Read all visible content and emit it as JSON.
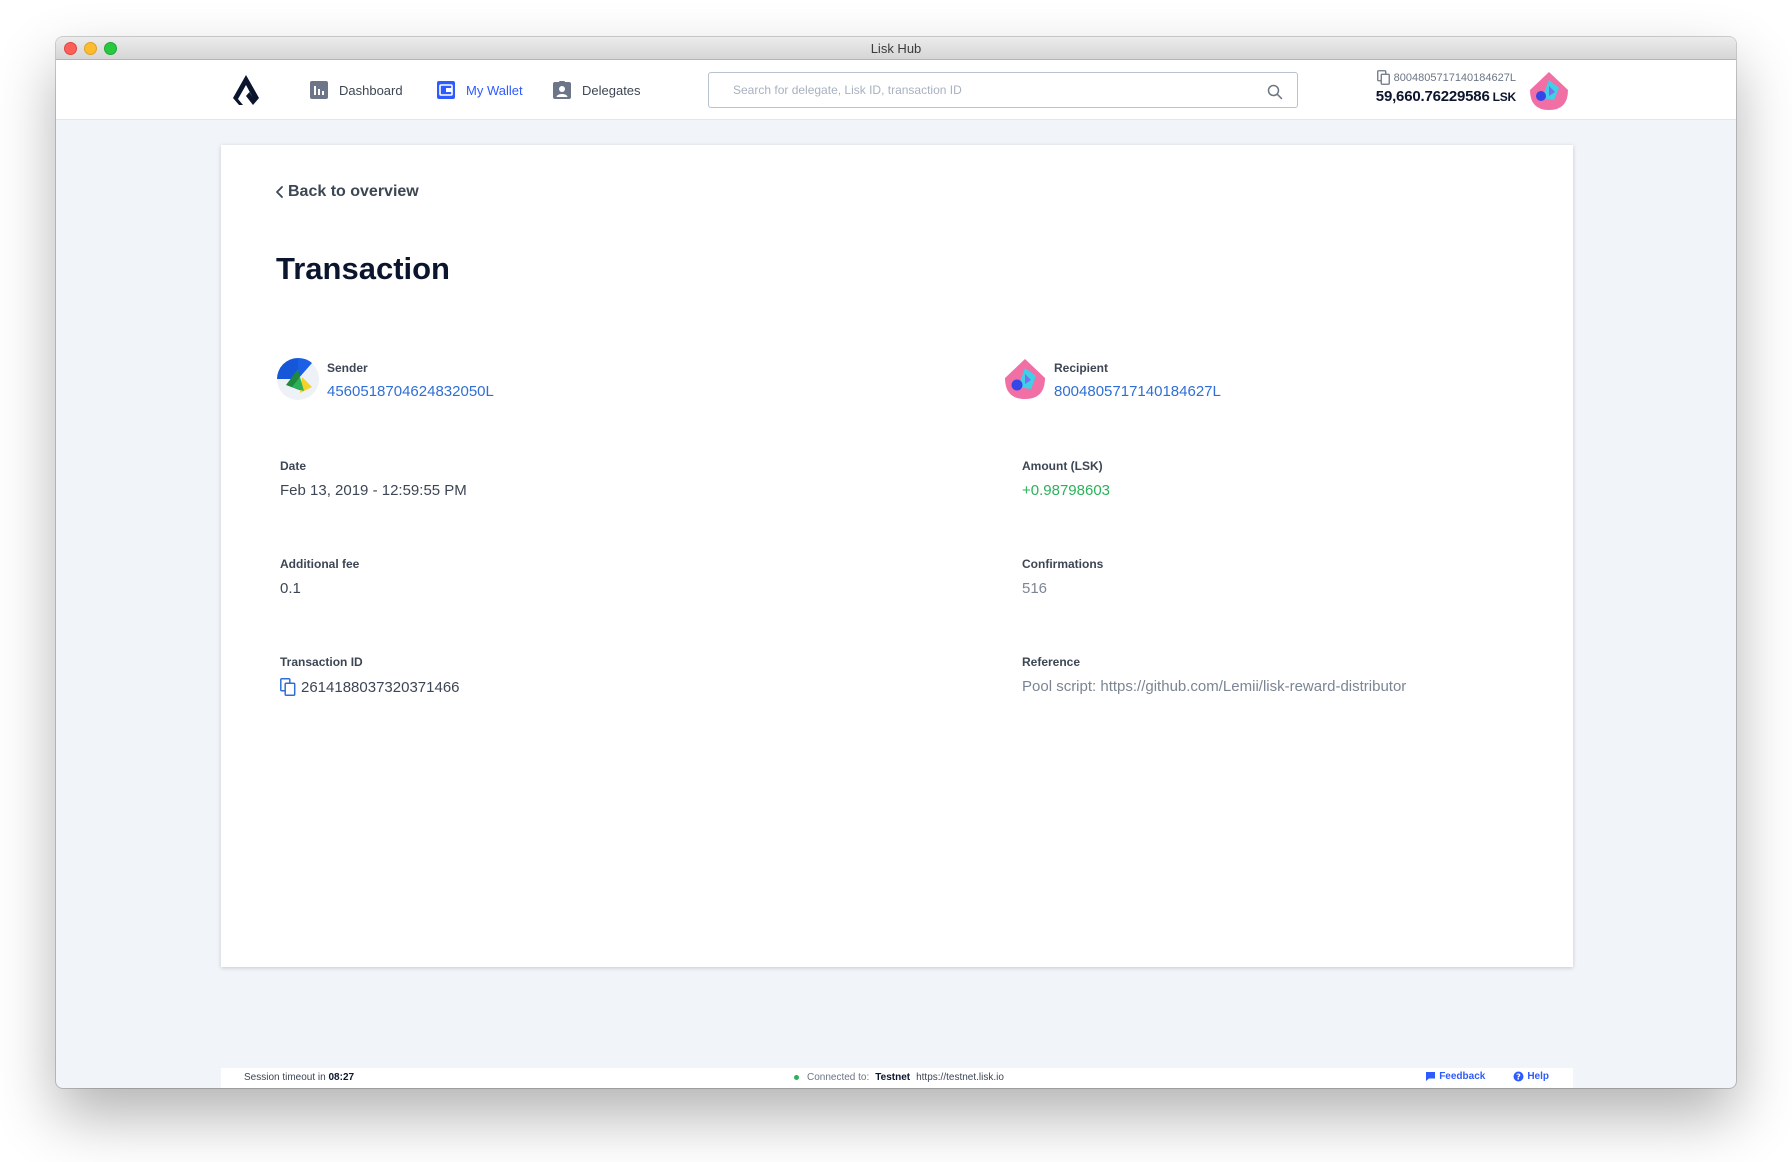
{
  "window": {
    "title": "Lisk Hub"
  },
  "nav": {
    "dashboard": "Dashboard",
    "wallet": "My Wallet",
    "delegates": "Delegates"
  },
  "search": {
    "placeholder": "Search for delegate, Lisk ID, transaction ID"
  },
  "account": {
    "address": "8004805717140184627L",
    "balance": "59,660.76229586",
    "unit": "LSK"
  },
  "page": {
    "back": "Back to overview",
    "title": "Transaction"
  },
  "transaction": {
    "sender_label": "Sender",
    "sender": "4560518704624832050L",
    "recipient_label": "Recipient",
    "recipient": "8004805717140184627L",
    "date_label": "Date",
    "date": "Feb 13, 2019 - 12:59:55 PM",
    "amount_label": "Amount (LSK)",
    "amount": "+0.98798603",
    "fee_label": "Additional fee",
    "fee": "0.1",
    "confirmations_label": "Confirmations",
    "confirmations": "516",
    "id_label": "Transaction ID",
    "id": "2614188037320371466",
    "reference_label": "Reference",
    "reference": "Pool script: https://github.com/Lemii/lisk-reward-distributor"
  },
  "footer": {
    "session_label": "Session timeout in",
    "session_time": "08:27",
    "connected_label": "Connected to:",
    "network": "Testnet",
    "network_url": "https://testnet.lisk.io",
    "feedback": "Feedback",
    "help": "Help"
  },
  "colors": {
    "accent": "#2e5bff",
    "link": "#2f6fd5",
    "positive": "#2bb15a",
    "background": "#f1f4f9"
  },
  "icons": [
    "lisk-logo-icon",
    "dashboard-icon",
    "wallet-icon",
    "delegates-icon",
    "search-icon",
    "copy-icon",
    "chevron-left-icon",
    "feedback-icon",
    "help-icon"
  ]
}
